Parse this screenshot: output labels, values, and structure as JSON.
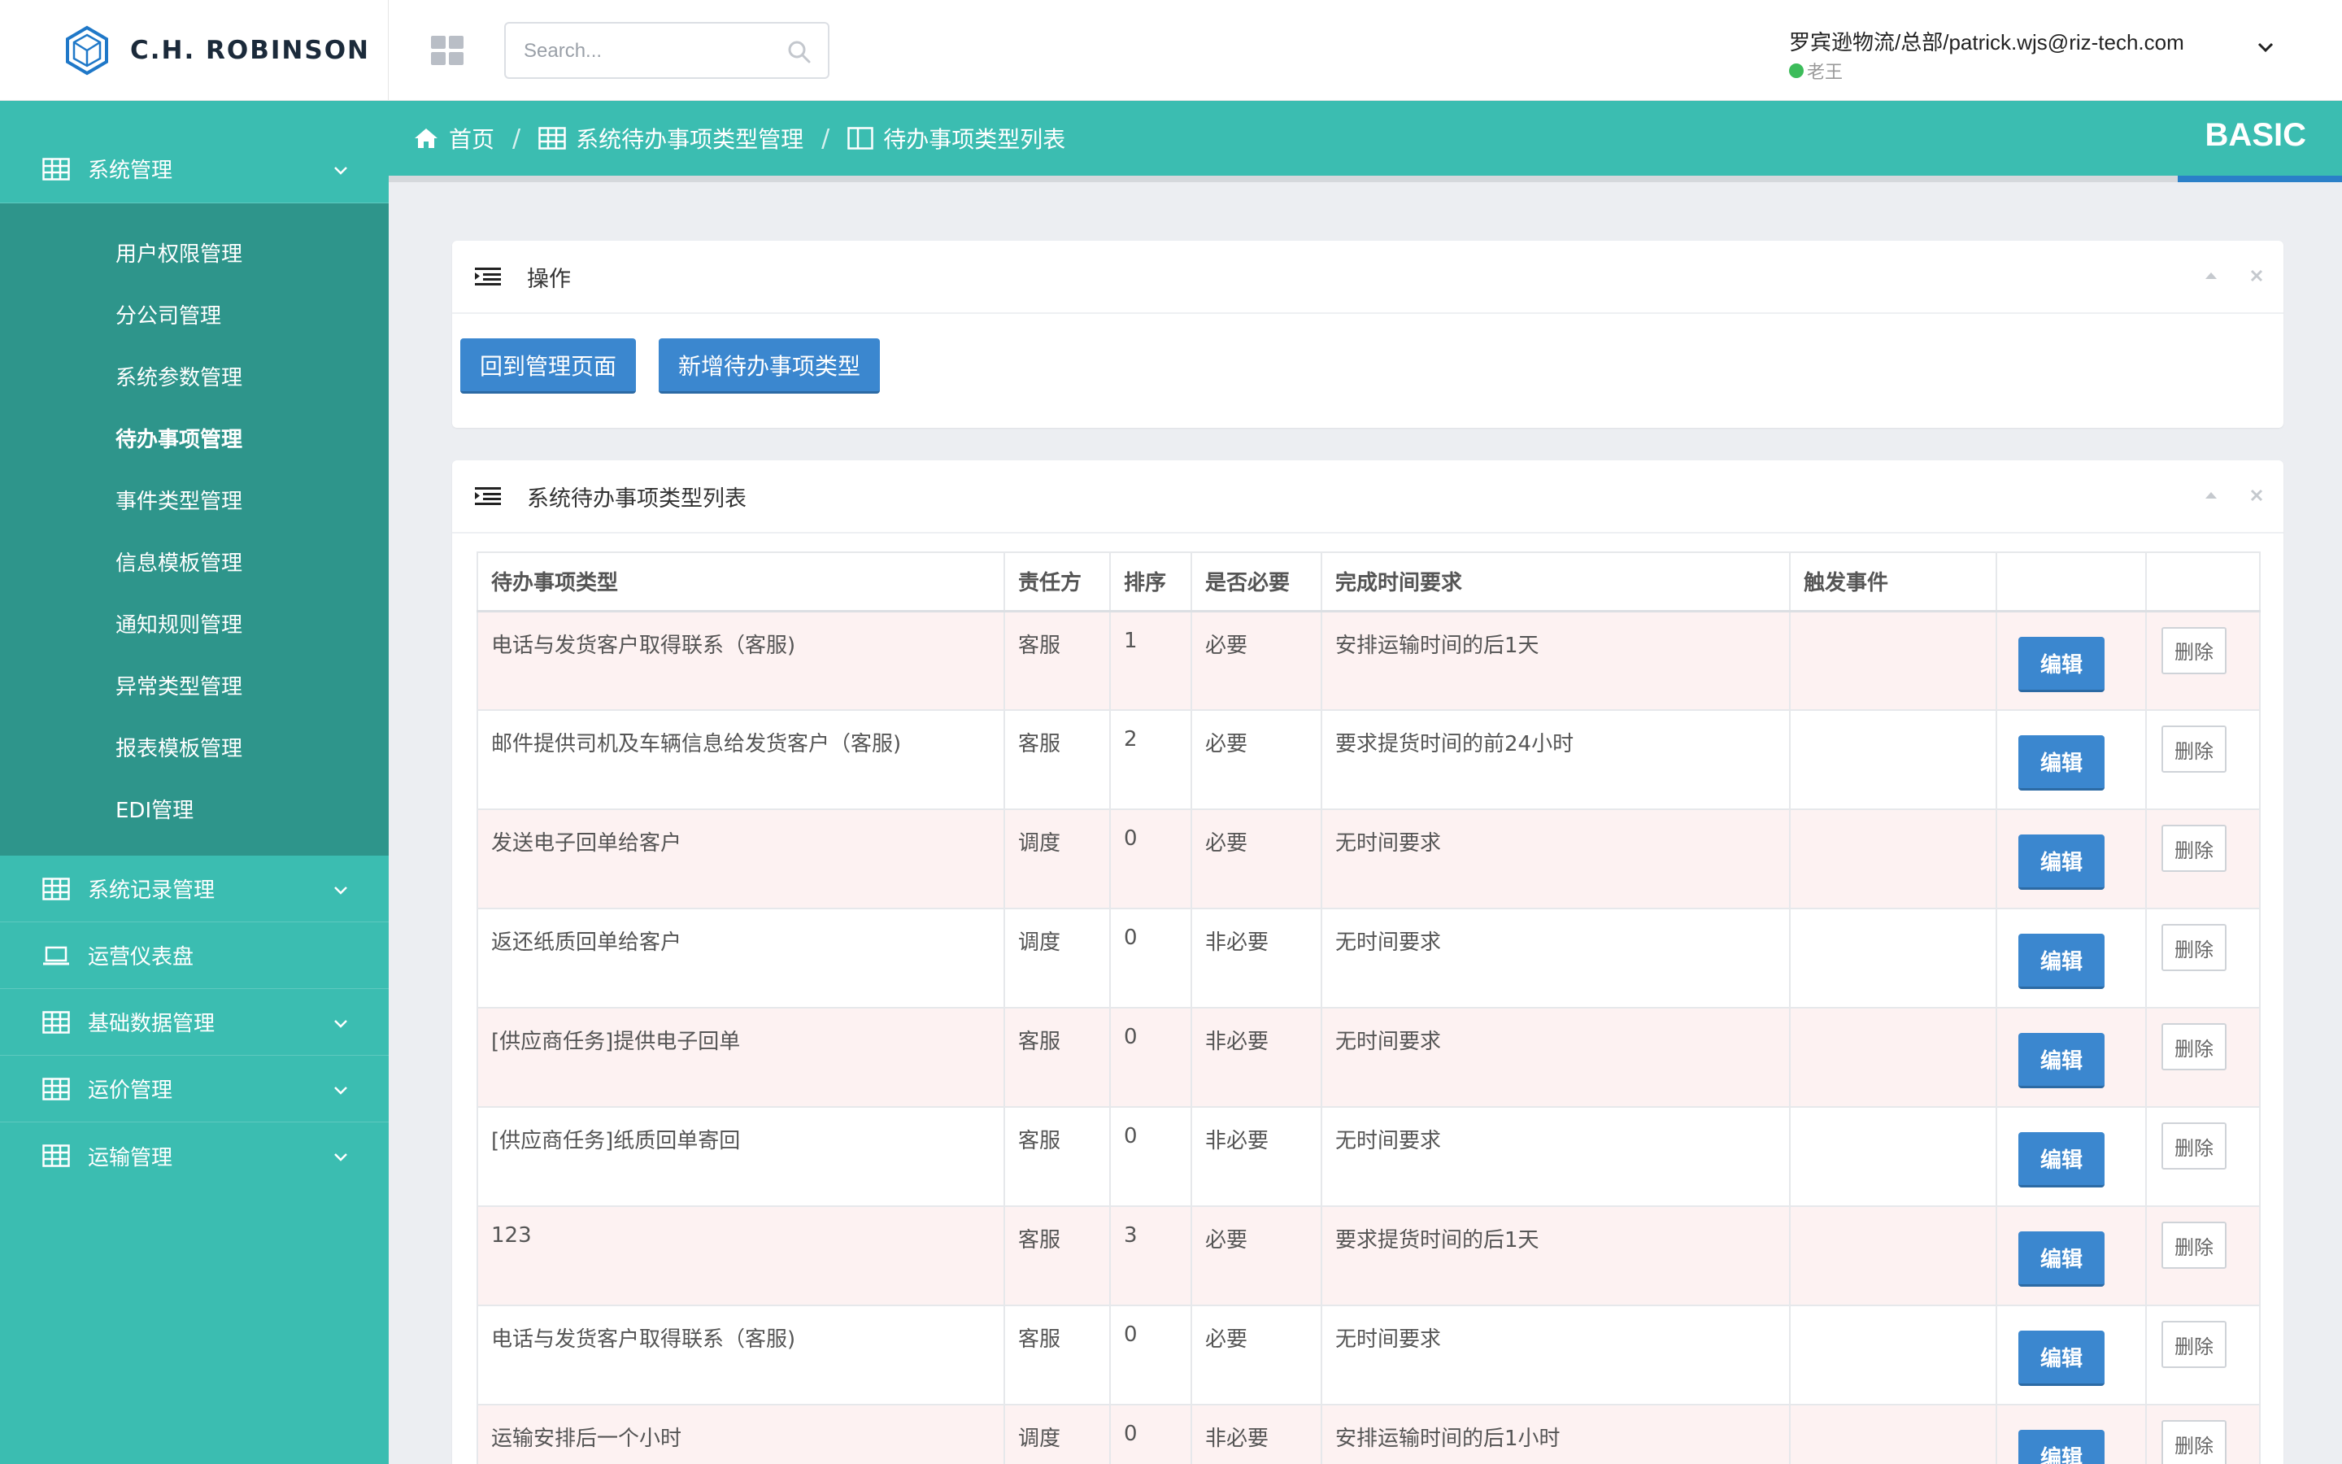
{
  "brand": {
    "name": "C.H. ROBINSON"
  },
  "search": {
    "placeholder": "Search..."
  },
  "user": {
    "account": "罗宾逊物流/总部/patrick.wjs@riz-tech.com",
    "nickname": "老王",
    "status_color": "#3cbc5a"
  },
  "sidebar": {
    "groups": [
      {
        "label": "系统管理",
        "icon": "table-icon",
        "expanded": true
      },
      {
        "label": "系统记录管理",
        "icon": "table-icon"
      },
      {
        "label": "运营仪表盘",
        "icon": "laptop-icon"
      },
      {
        "label": "基础数据管理",
        "icon": "table-icon"
      },
      {
        "label": "运价管理",
        "icon": "table-icon"
      },
      {
        "label": "运输管理",
        "icon": "table-icon"
      }
    ],
    "submenu": [
      "用户权限管理",
      "分公司管理",
      "系统参数管理",
      "待办事项管理",
      "事件类型管理",
      "信息模板管理",
      "通知规则管理",
      "异常类型管理",
      "报表模板管理",
      "EDI管理"
    ],
    "active_submenu": "待办事项管理"
  },
  "breadcrumb": {
    "home": "首页",
    "section": "系统待办事项类型管理",
    "page": "待办事项类型列表",
    "separator": "/"
  },
  "plan_label": "BASIC",
  "ops_panel": {
    "title": "操作",
    "back_button": "回到管理页面",
    "add_button": "新增待办事项类型"
  },
  "list_panel": {
    "title": "系统待办事项类型列表",
    "columns": [
      "待办事项类型",
      "责任方",
      "排序",
      "是否必要",
      "完成时间要求",
      "触发事件",
      "",
      ""
    ],
    "edit_label": "编辑",
    "delete_label": "删除",
    "rows": [
      {
        "type": "电话与发货客户取得联系（客服)",
        "owner": "客服",
        "order": "1",
        "required": "必要",
        "time": "安排运输时间的后1天",
        "trigger": ""
      },
      {
        "type": "邮件提供司机及车辆信息给发货客户（客服)",
        "owner": "客服",
        "order": "2",
        "required": "必要",
        "time": "要求提货时间的前24小时",
        "trigger": ""
      },
      {
        "type": "发送电子回单给客户",
        "owner": "调度",
        "order": "0",
        "required": "必要",
        "time": "无时间要求",
        "trigger": ""
      },
      {
        "type": "返还纸质回单给客户",
        "owner": "调度",
        "order": "0",
        "required": "非必要",
        "time": "无时间要求",
        "trigger": ""
      },
      {
        "type": "[供应商任务]提供电子回单",
        "owner": "客服",
        "order": "0",
        "required": "非必要",
        "time": "无时间要求",
        "trigger": ""
      },
      {
        "type": "[供应商任务]纸质回单寄回",
        "owner": "客服",
        "order": "0",
        "required": "非必要",
        "time": "无时间要求",
        "trigger": ""
      },
      {
        "type": "123",
        "owner": "客服",
        "order": "3",
        "required": "必要",
        "time": "要求提货时间的后1天",
        "trigger": ""
      },
      {
        "type": "电话与发货客户取得联系（客服)",
        "owner": "客服",
        "order": "0",
        "required": "必要",
        "time": "无时间要求",
        "trigger": ""
      },
      {
        "type": "运输安排后一个小时",
        "owner": "调度",
        "order": "0",
        "required": "非必要",
        "time": "安排运输时间的后1小时",
        "trigger": ""
      }
    ]
  },
  "colors": {
    "teal": "#3bbdb1",
    "teal_dark": "#2e958b",
    "primary": "#3b87cf",
    "row_alt": "#fdf2f2"
  }
}
